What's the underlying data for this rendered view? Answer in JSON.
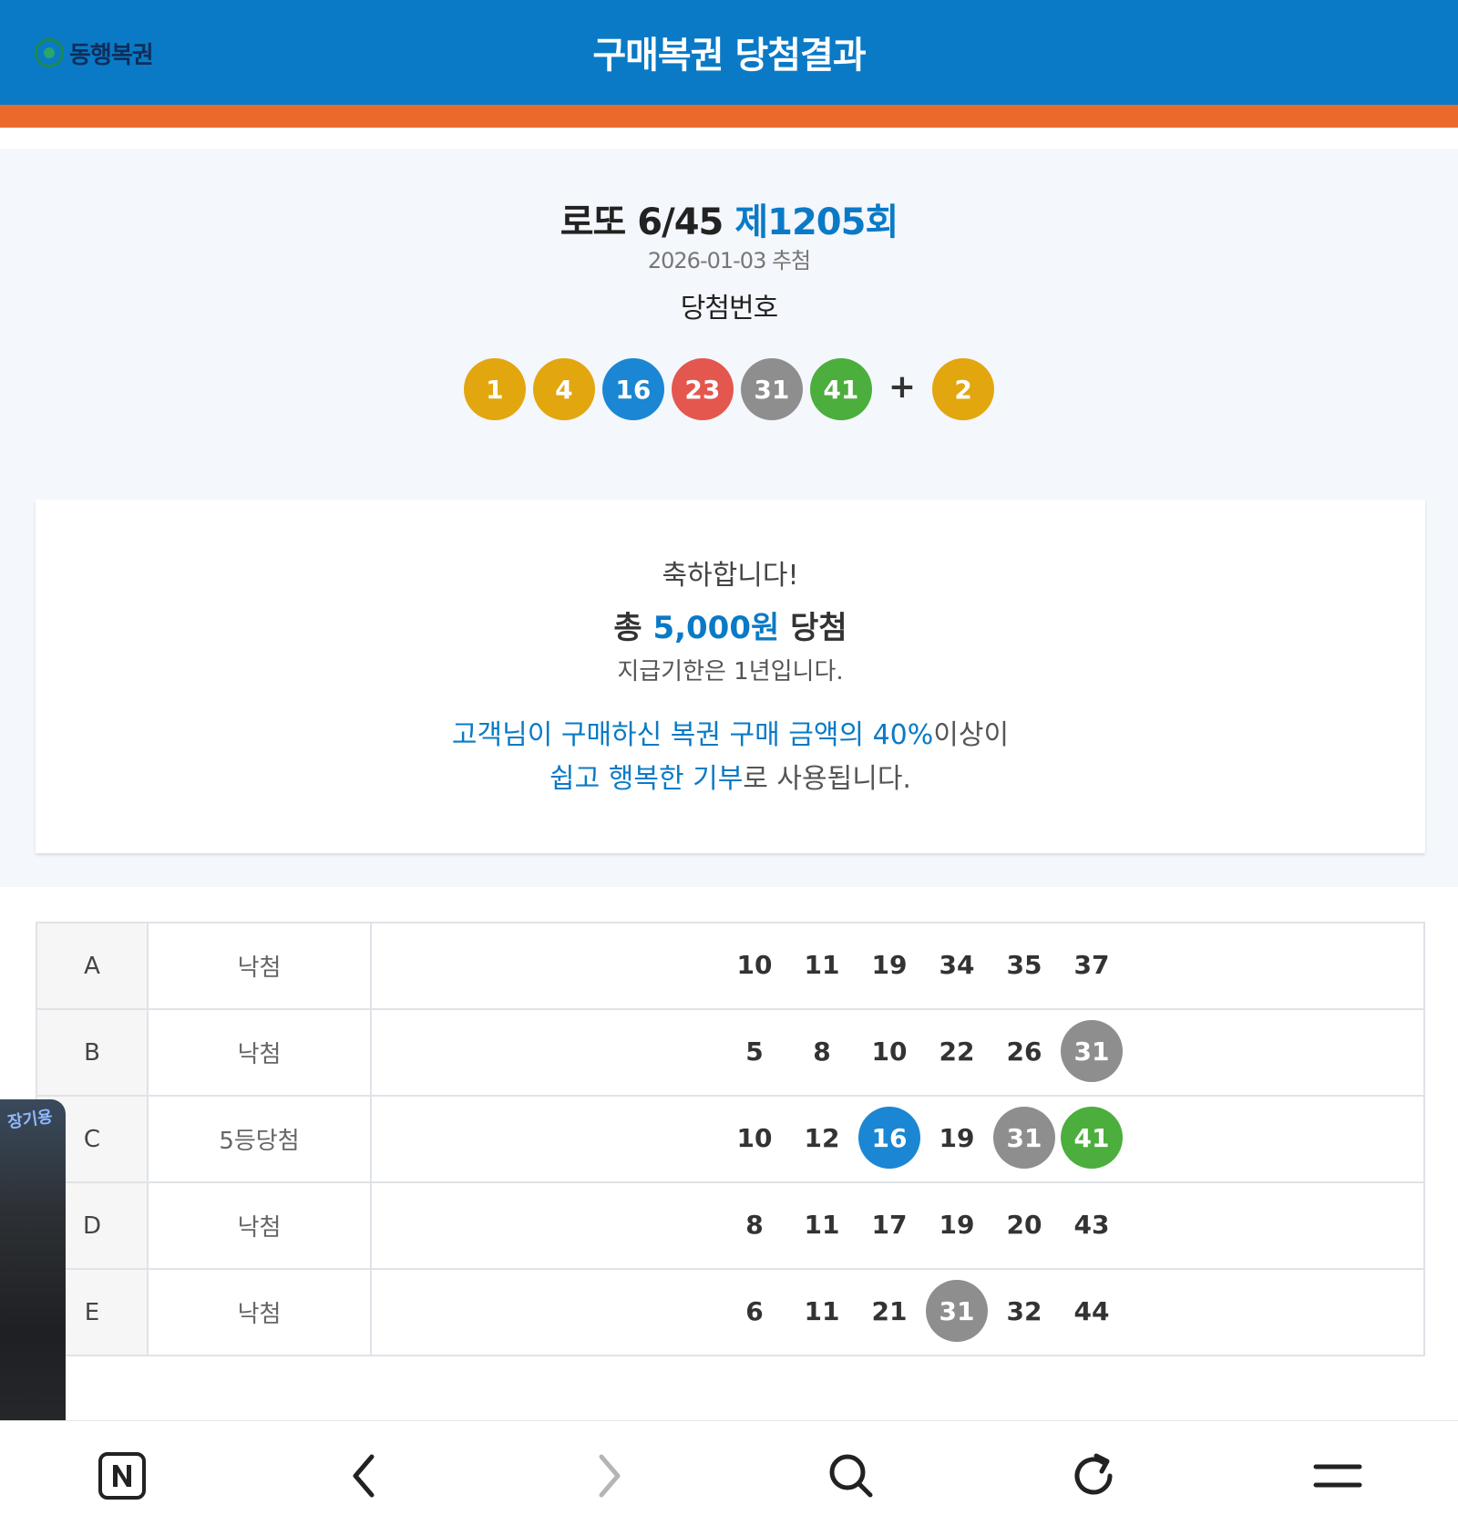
{
  "header": {
    "logo_text": "동행복권",
    "title": "구매복권 당첨결과"
  },
  "draw": {
    "game": "로또 6/45",
    "round": "제1205회",
    "date": "2026-01-03 추첨",
    "numbers_label": "당첨번호",
    "plus": "+",
    "numbers": [
      {
        "value": "1",
        "color": "#e2a60f"
      },
      {
        "value": "4",
        "color": "#e2a60f"
      },
      {
        "value": "16",
        "color": "#1b86d3"
      },
      {
        "value": "23",
        "color": "#e4574e"
      },
      {
        "value": "31",
        "color": "#8e8e8e"
      },
      {
        "value": "41",
        "color": "#4cae3d"
      }
    ],
    "bonus": {
      "value": "2",
      "color": "#e2a60f"
    }
  },
  "result": {
    "congrats": "축하합니다!",
    "total_prefix": "총 ",
    "total_amount": "5,000원",
    "total_suffix": " 당첨",
    "deadline": "지급기한은 1년입니다.",
    "donation_line1_highlight": "고객님이 구매하신 복권 구매 금액의 40%",
    "donation_line1_rest": "이상이",
    "donation_line2_highlight": "쉽고 행복한 기부",
    "donation_line2_rest": "로 사용됩니다."
  },
  "rows": [
    {
      "id": "A",
      "result": "낙첨",
      "numbers": [
        {
          "v": "10",
          "c": null
        },
        {
          "v": "11",
          "c": null
        },
        {
          "v": "19",
          "c": null
        },
        {
          "v": "34",
          "c": null
        },
        {
          "v": "35",
          "c": null
        },
        {
          "v": "37",
          "c": null
        }
      ]
    },
    {
      "id": "B",
      "result": "낙첨",
      "numbers": [
        {
          "v": "5",
          "c": null
        },
        {
          "v": "8",
          "c": null
        },
        {
          "v": "10",
          "c": null
        },
        {
          "v": "22",
          "c": null
        },
        {
          "v": "26",
          "c": null
        },
        {
          "v": "31",
          "c": "#8e8e8e"
        }
      ]
    },
    {
      "id": "C",
      "result": "5등당첨",
      "numbers": [
        {
          "v": "10",
          "c": null
        },
        {
          "v": "12",
          "c": null
        },
        {
          "v": "16",
          "c": "#1b86d3"
        },
        {
          "v": "19",
          "c": null
        },
        {
          "v": "31",
          "c": "#8e8e8e"
        },
        {
          "v": "41",
          "c": "#4cae3d"
        }
      ]
    },
    {
      "id": "D",
      "result": "낙첨",
      "numbers": [
        {
          "v": "8",
          "c": null
        },
        {
          "v": "11",
          "c": null
        },
        {
          "v": "17",
          "c": null
        },
        {
          "v": "19",
          "c": null
        },
        {
          "v": "20",
          "c": null
        },
        {
          "v": "43",
          "c": null
        }
      ]
    },
    {
      "id": "E",
      "result": "낙첨",
      "numbers": [
        {
          "v": "6",
          "c": null
        },
        {
          "v": "11",
          "c": null
        },
        {
          "v": "21",
          "c": null
        },
        {
          "v": "31",
          "c": "#8e8e8e"
        },
        {
          "v": "32",
          "c": null
        },
        {
          "v": "44",
          "c": null
        }
      ]
    }
  ],
  "floating_widget": {
    "label": "장기용"
  },
  "bottom_nav": {
    "icons": [
      "naver-icon",
      "back-icon",
      "forward-icon",
      "search-icon",
      "refresh-icon",
      "menu-icon"
    ]
  }
}
